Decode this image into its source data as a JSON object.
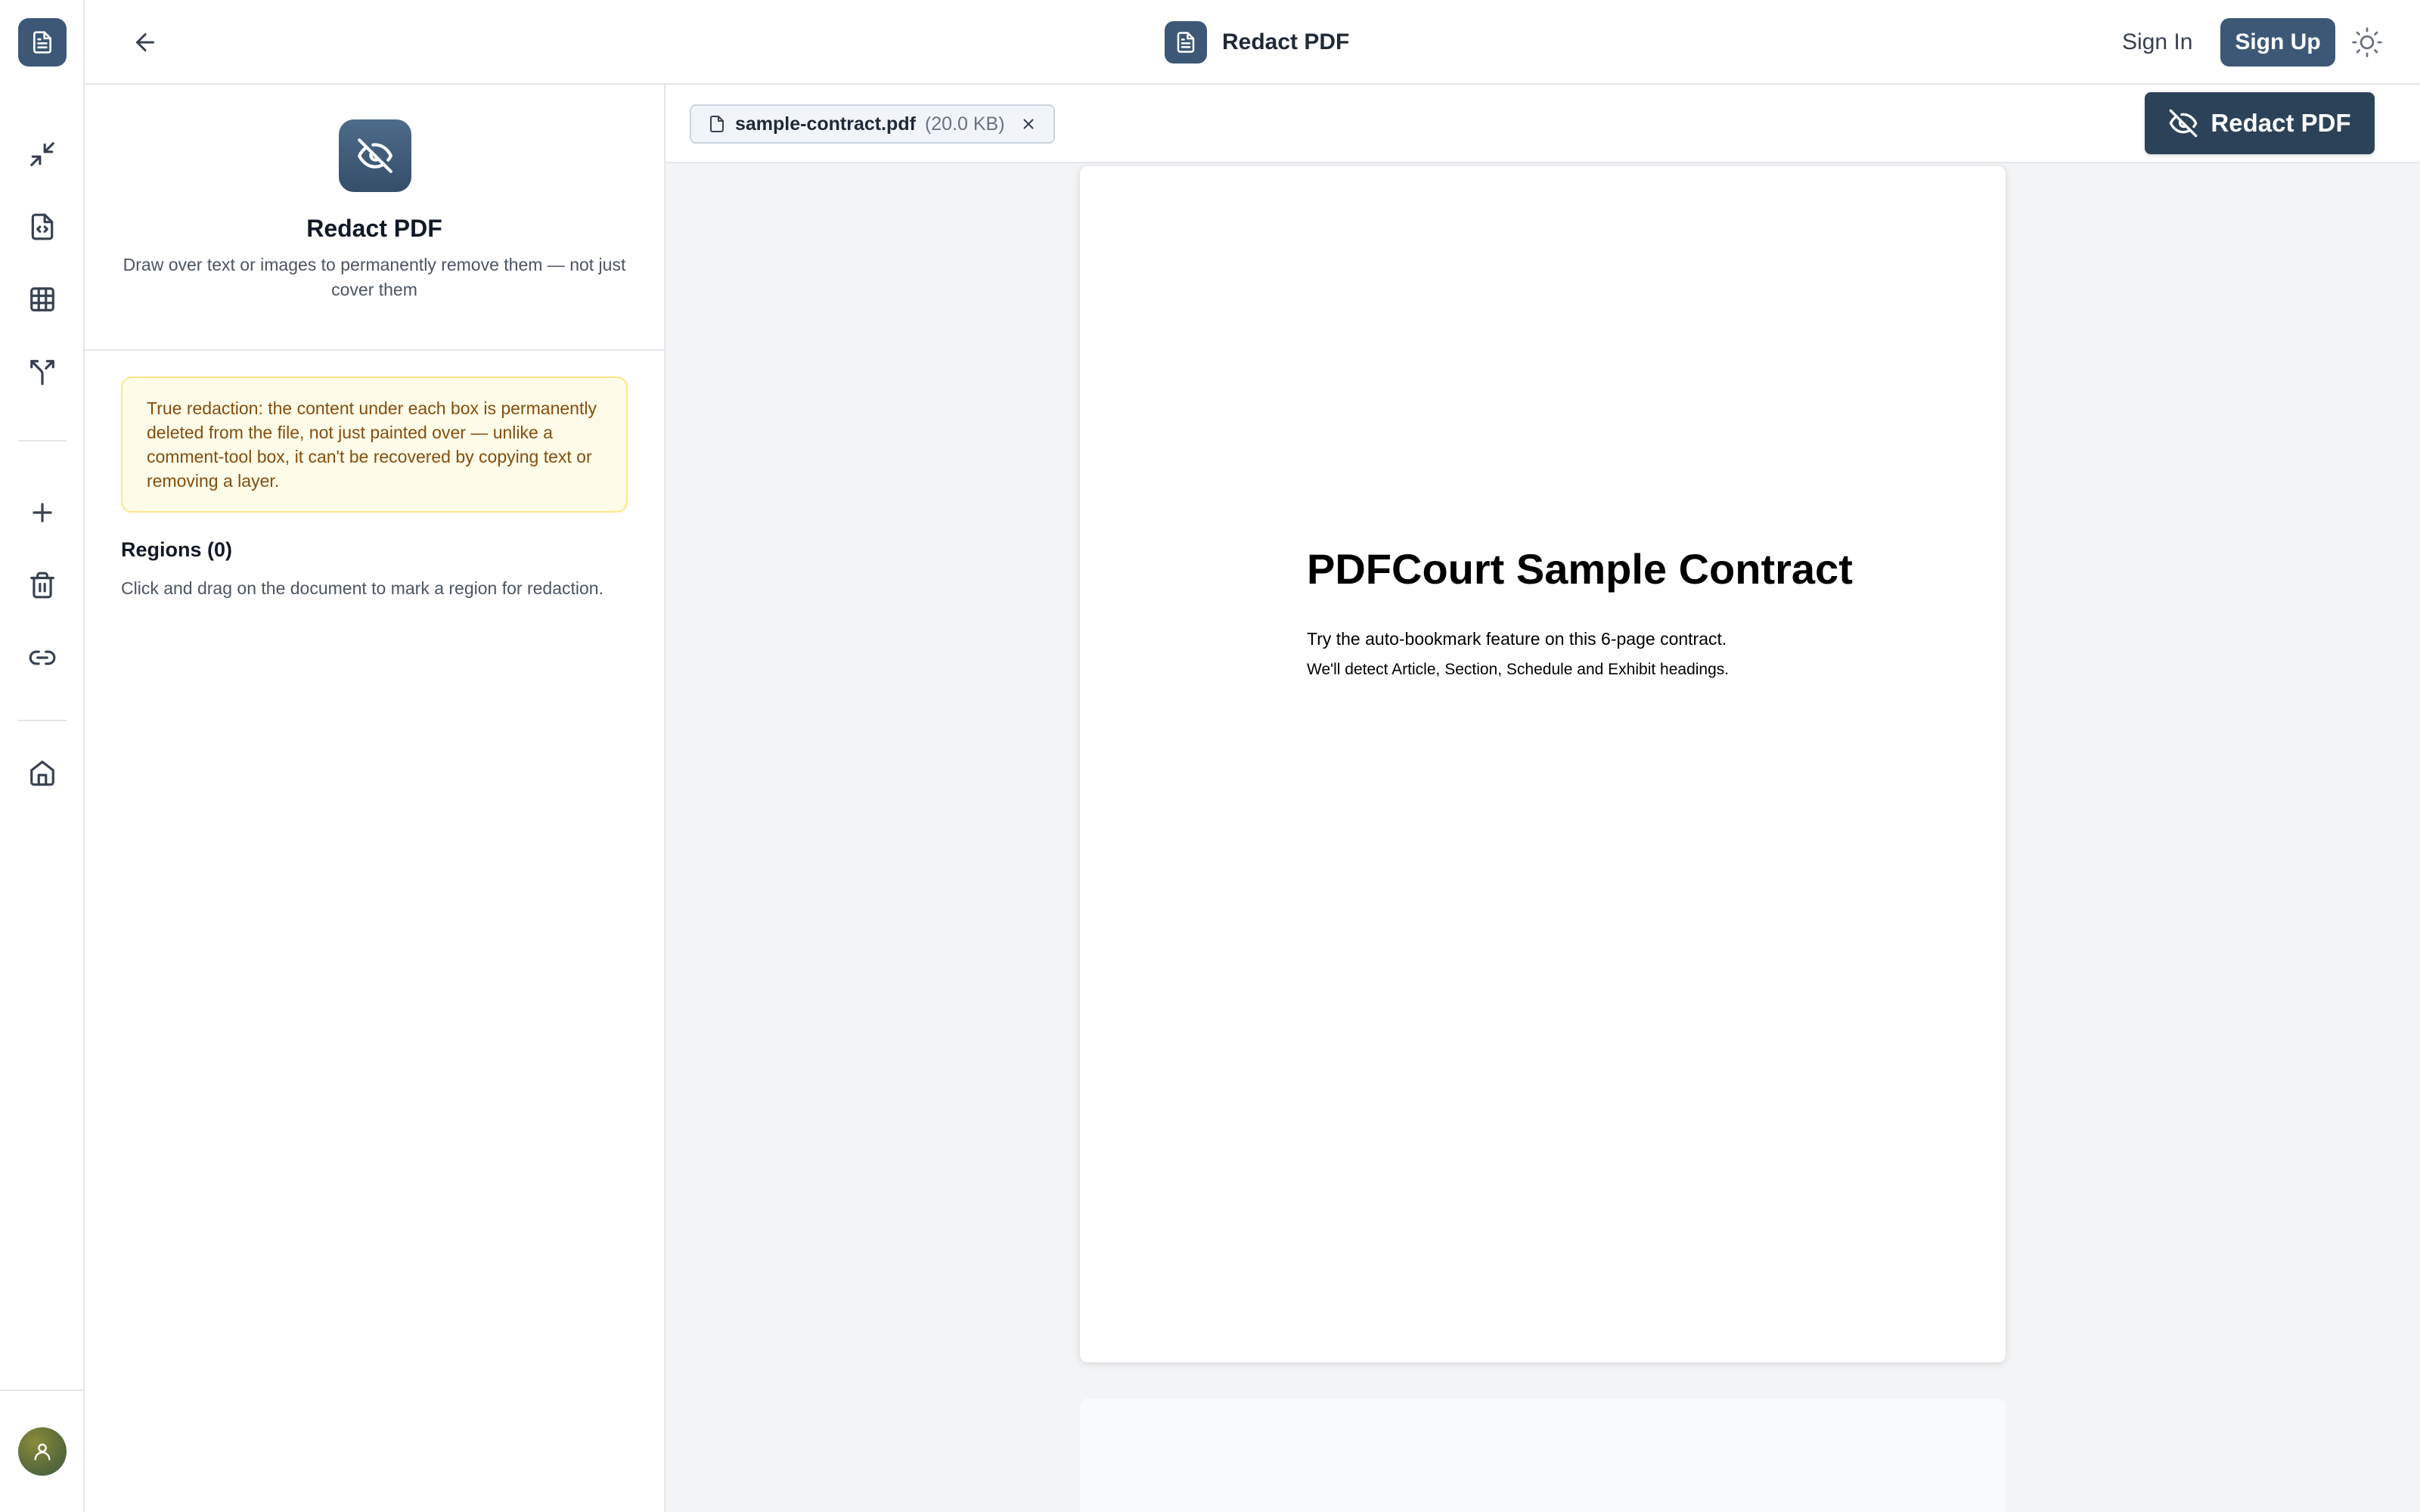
{
  "header": {
    "title": "Redact PDF",
    "sign_in": "Sign In",
    "sign_up": "Sign Up"
  },
  "sidebar": {
    "items": [
      {
        "name": "compress",
        "icon": "minimize-arrows-icon"
      },
      {
        "name": "pdf-to-code",
        "icon": "file-code-icon"
      },
      {
        "name": "table",
        "icon": "grid-table-icon"
      },
      {
        "name": "split",
        "icon": "split-arrows-icon"
      },
      {
        "name": "add",
        "icon": "plus-icon"
      },
      {
        "name": "delete",
        "icon": "trash-icon"
      },
      {
        "name": "link",
        "icon": "link-icon"
      },
      {
        "name": "home",
        "icon": "home-icon"
      }
    ]
  },
  "panel": {
    "title": "Redact PDF",
    "description": "Draw over text or images to permanently remove them — not just cover them",
    "notice": "True redaction: the content under each box is permanently deleted from the file, not just painted over — unlike a comment-tool box, it can't be recovered by copying text or removing a layer.",
    "regions_title": "Regions (0)",
    "regions_hint": "Click and drag on the document to mark a region for redaction."
  },
  "file": {
    "name": "sample-contract.pdf",
    "size": "(20.0 KB)"
  },
  "toolbar": {
    "redact_label": "Redact PDF"
  },
  "document": {
    "title": "PDFCourt Sample Contract",
    "line1": "Try the auto-bookmark feature on this 6-page contract.",
    "line2": "We'll detect Article, Section, Schedule and Exhibit headings."
  },
  "colors": {
    "brand": "#3d5876",
    "primary_button": "#2c4258",
    "notice_bg": "#fefce8",
    "notice_text": "#854d0e"
  }
}
